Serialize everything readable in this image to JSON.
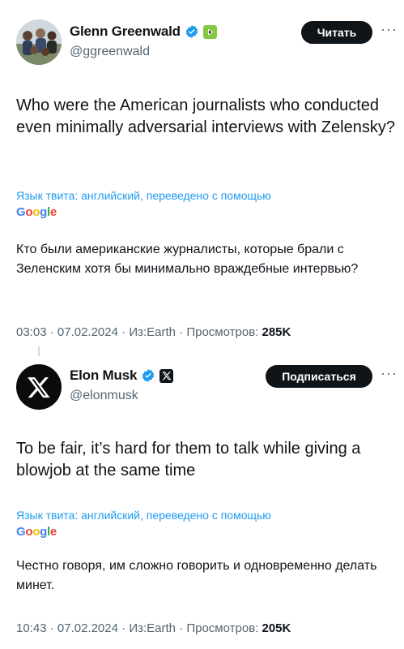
{
  "tweets": [
    {
      "author_name": "Glenn Greenwald",
      "handle": "@ggreenwald",
      "action_label": "Читать",
      "text": "Who were the American journalists who conducted even minimally adversarial interviews with Zelensky?",
      "lang_note": "Язык твита: английский, переведено с помощью",
      "translator": "Google",
      "translation": "Кто были американские журналисты, которые брали с Зеленским хотя бы минимально враждебные интервью?",
      "time": "03:03",
      "date": "07.02.2024",
      "source": "Из:Earth",
      "views_label": "Просмотров:",
      "views": "285K"
    },
    {
      "author_name": "Elon Musk",
      "handle": "@elonmusk",
      "action_label": "Подписаться",
      "text": "To be fair, it’s hard for them to talk while giving a blowjob at the same time",
      "lang_note": "Язык твита: английский, переведено с помощью",
      "translator": "Google",
      "translation": "Честно говоря, им сложно говорить и одновременно делать минет.",
      "time": "10:43",
      "date": "07.02.2024",
      "source": "Из:Earth",
      "views_label": "Просмотров:",
      "views": "205K"
    }
  ],
  "colors": {
    "text": "#0f1419",
    "secondary": "#536471",
    "link": "#1d9bf0",
    "verified": "#1d9bf0",
    "button_bg": "#0f1419",
    "rumble_green": "#85c742"
  },
  "icons": {
    "verified": "verified-badge-icon",
    "rumble": "rumble-affiliate-icon",
    "x_affiliate": "x-logo-icon",
    "more": "more-dots-icon"
  }
}
